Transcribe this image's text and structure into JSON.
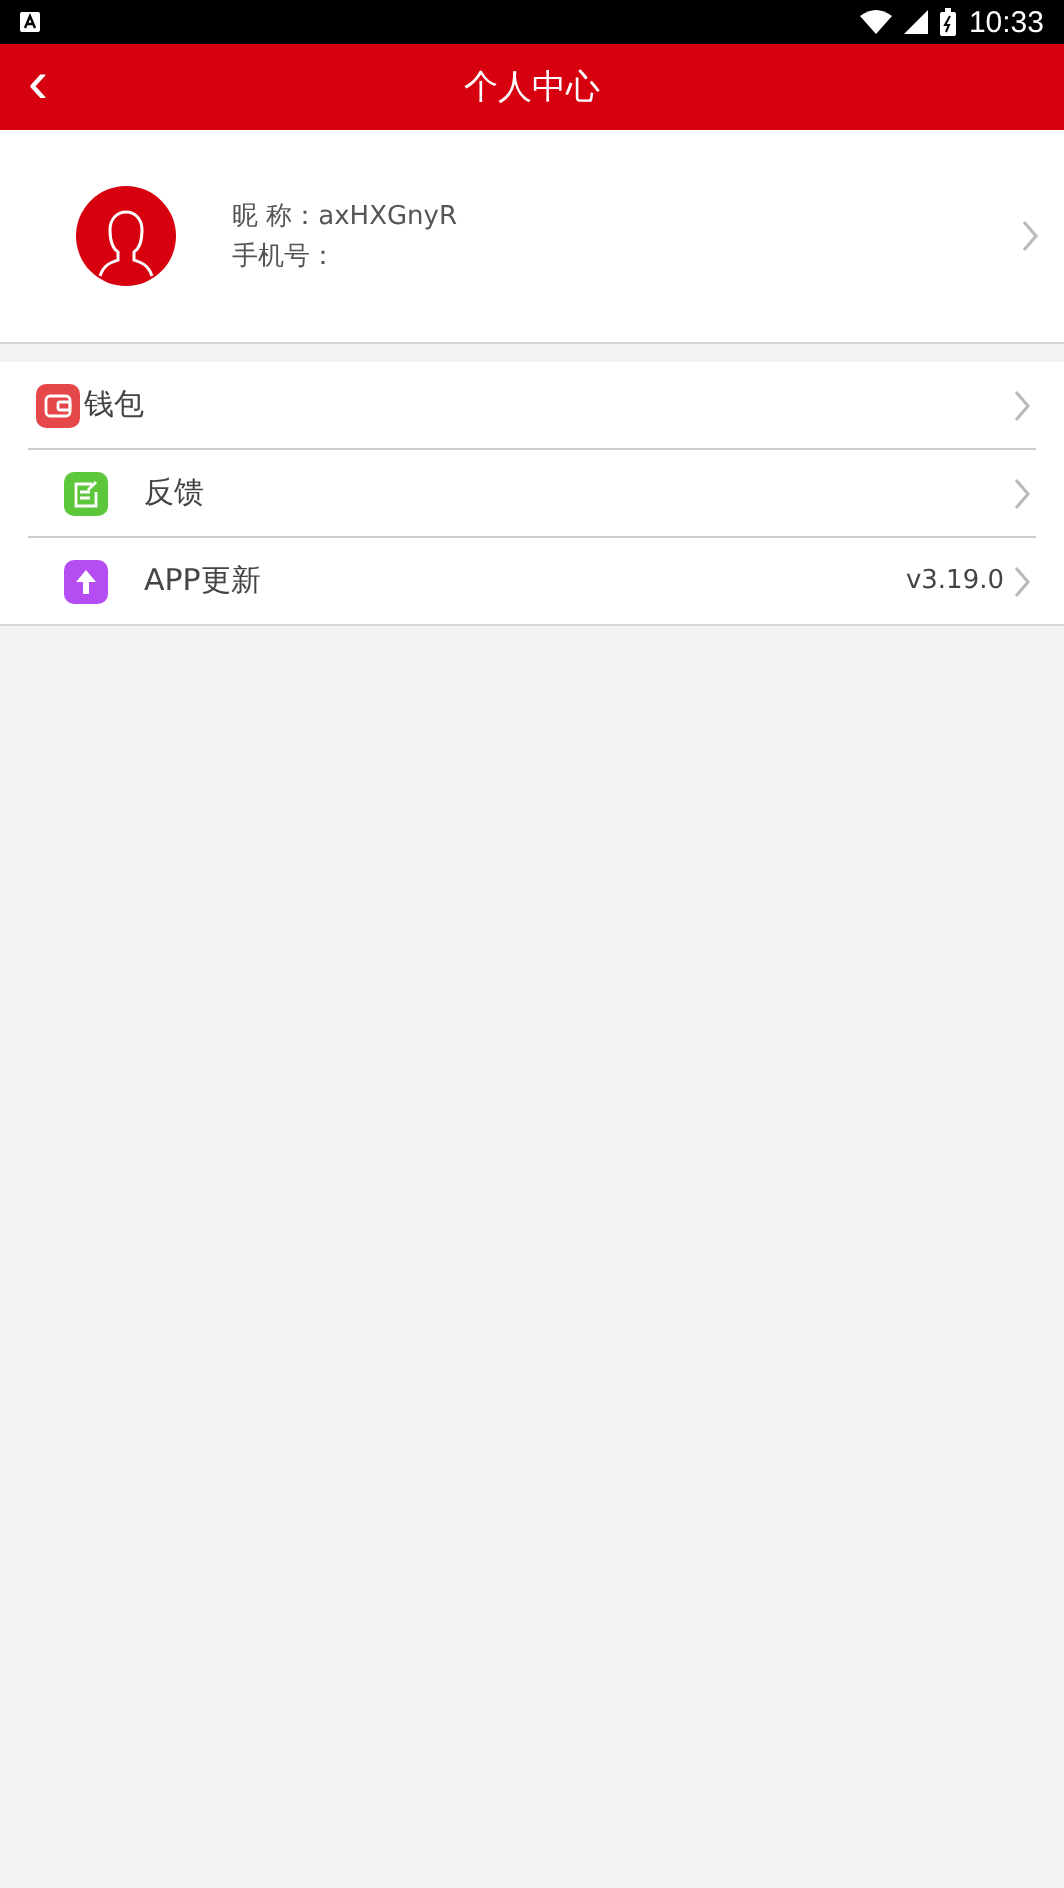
{
  "status_bar": {
    "time": "10:33"
  },
  "header": {
    "back": "‹",
    "title": "个人中心"
  },
  "profile": {
    "nickname_label": "昵 称：",
    "nickname": "axHXGnyR",
    "phone_label": "手机号："
  },
  "menu": [
    {
      "label": "钱包",
      "kind": "wallet",
      "color": "#e5474a",
      "compact": true
    },
    {
      "label": "反馈",
      "kind": "note",
      "color": "#5cc73b",
      "compact": false
    },
    {
      "label": "APP更新",
      "kind": "upload",
      "color": "#b44ef2",
      "compact": false,
      "value": "v3.19.0"
    }
  ]
}
